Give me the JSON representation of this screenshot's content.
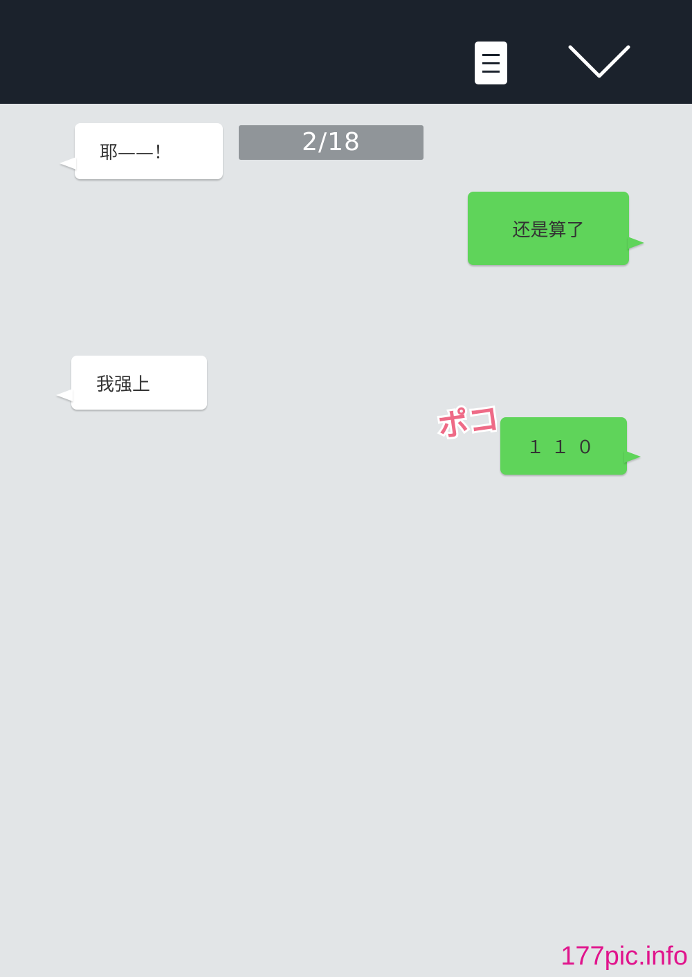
{
  "header": {
    "menu_icon": "menu-document-icon",
    "collapse_icon": "chevron-down-icon",
    "background_color": "#1b222c"
  },
  "page_counter": "2/18",
  "messages": [
    {
      "side": "left",
      "text": "耶——！"
    },
    {
      "side": "right",
      "text": "还是算了"
    },
    {
      "side": "left",
      "text": "我强上"
    },
    {
      "side": "right",
      "text": "１１０"
    }
  ],
  "sound_effect": "ポコ",
  "watermark": "177pic.info",
  "colors": {
    "background": "#e2e5e7",
    "incoming_bubble": "#ffffff",
    "outgoing_bubble": "#5fd45a",
    "counter": "#909599",
    "sound_effect": "#ee6a86",
    "watermark": "#e0148c"
  }
}
